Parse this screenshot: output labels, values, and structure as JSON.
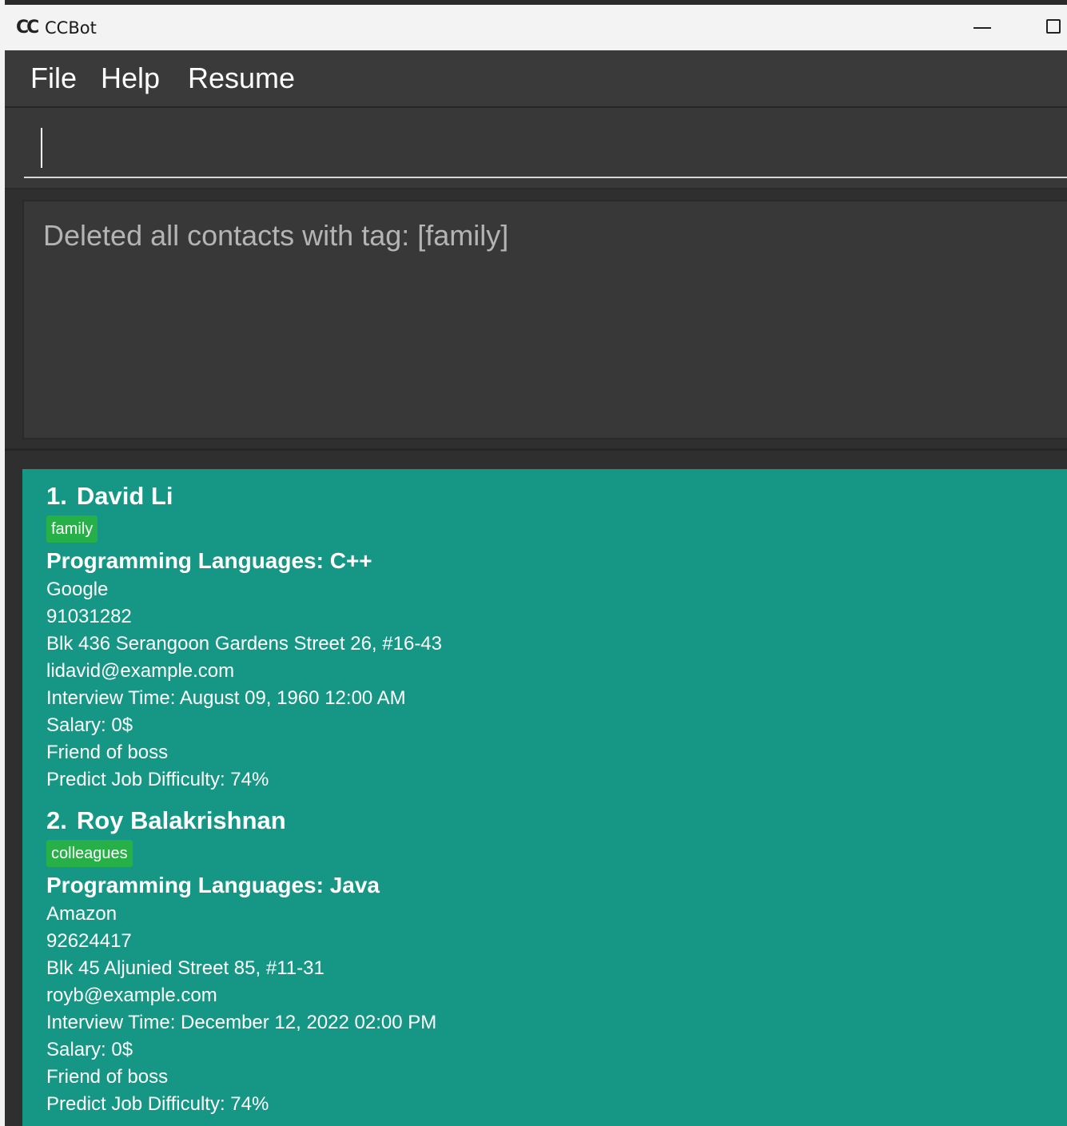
{
  "window": {
    "title": "CCBot",
    "icon_text": "CC"
  },
  "menu": {
    "file": "File",
    "help": "Help",
    "resume": "Resume"
  },
  "command": {
    "value": "",
    "placeholder": ""
  },
  "result": {
    "message": "Deleted all contacts with tag: [family]"
  },
  "contacts": [
    {
      "index": "1.",
      "name": "David Li",
      "tag": "family",
      "languages": "Programming Languages: C++",
      "company": "Google",
      "phone": "91031282",
      "address": "Blk 436 Serangoon Gardens Street 26, #16-43",
      "email": "lidavid@example.com",
      "interview": "Interview Time: August 09, 1960 12:00 AM",
      "salary": "Salary: 0$",
      "remark": "Friend of boss",
      "difficulty": "Predict Job Difficulty: 74%"
    },
    {
      "index": "2.",
      "name": "Roy Balakrishnan",
      "tag": "colleagues",
      "languages": "Programming Languages: Java",
      "company": "Amazon",
      "phone": "92624417",
      "address": "Blk 45 Aljunied Street 85, #11-31",
      "email": "royb@example.com",
      "interview": "Interview Time: December 12, 2022 02:00 PM",
      "salary": "Salary: 0$",
      "remark": "Friend of boss",
      "difficulty": "Predict Job Difficulty: 74%"
    }
  ],
  "colors": {
    "list_background": "#169685",
    "tag_background": "#28b048",
    "menu_background": "#3a3a3a",
    "result_text": "#b4b4b4"
  }
}
